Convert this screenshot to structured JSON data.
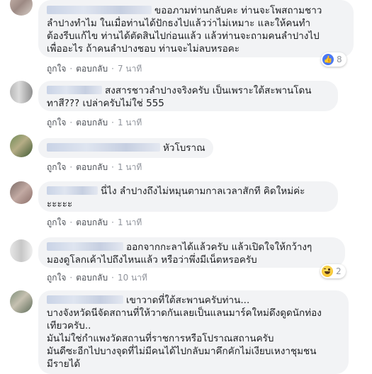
{
  "comments": [
    {
      "lines": [
        "ขออภามท่านกลับคะ ท่านจะโพสถามชาว",
        "ลำปางทำไม ในเมื่อท่านได้ปักธงไปแล้วว่าไม่เหมาะ และให้คนทำ",
        "ต้องรีบแก้ไข ท่านได้ตัดสินไปก่อนแล้ว แล้วท่านจะถามคนลำปางไป",
        "เพื่ออะไร ถ้าคนลำปางชอบ ท่านจะไม่ลบหรอคะ"
      ],
      "like": "ถูกใจ",
      "reply": "ตอบกลับ",
      "time": "7 นาที",
      "reaction": {
        "icon": "like-icon",
        "count": "8"
      }
    },
    {
      "lines": [
        "สงสารชาวลำปางจริงครับ เป็นเพราะใต้สะพานโดน",
        "ทาสี??? เปล่าครับไม่ใช่ 555"
      ],
      "like": "ถูกใจ",
      "reply": "ตอบกลับ",
      "time": "1 นาที"
    },
    {
      "lines": [
        "หัวโบราณ"
      ],
      "like": "ถูกใจ",
      "reply": "ตอบกลับ",
      "time": "1 นาที"
    },
    {
      "lines": [
        "นี่ไง ลำปางถึงไม่หมุนตามกาลเวลาสักที คิดใหม่ค่ะ",
        "ะะะะะ"
      ],
      "like": "ถูกใจ",
      "reply": "ตอบกลับ",
      "time": "1 นาที"
    },
    {
      "lines": [
        "ออกจากกะลาได้แล้วครับ แล้วเปิดใจให้กว้างๆ",
        "มองดูโลกเค้าไปถึงไหนแล้ว หรือว่าพึ่งมีเน็ตหรอครับ"
      ],
      "like": "ถูกใจ",
      "reply": "ตอบกลับ",
      "time": "10 นาที",
      "reaction": {
        "icon": "haha-icon",
        "count": "2"
      }
    },
    {
      "lines": [
        "เขาวาดที่ใต้สะพานครับท่าน...",
        "บางจังหวัดนีจัดสถานที่ให้วาดกันเลยเป็นแลนมาร์คใหม่ดึงดูดนักท่อง",
        "เทียวครับ..",
        "มันไม่ใช่กำแพงวัดสถานที่ราชการหรือโปราณสถานครับ",
        "มันดีซะอีกไปบางจุดที่ไม่มีคนได้ไปกลับมาคึกคักไม่เงียบเหงาชุมชน",
        "มีรายได้"
      ]
    }
  ]
}
